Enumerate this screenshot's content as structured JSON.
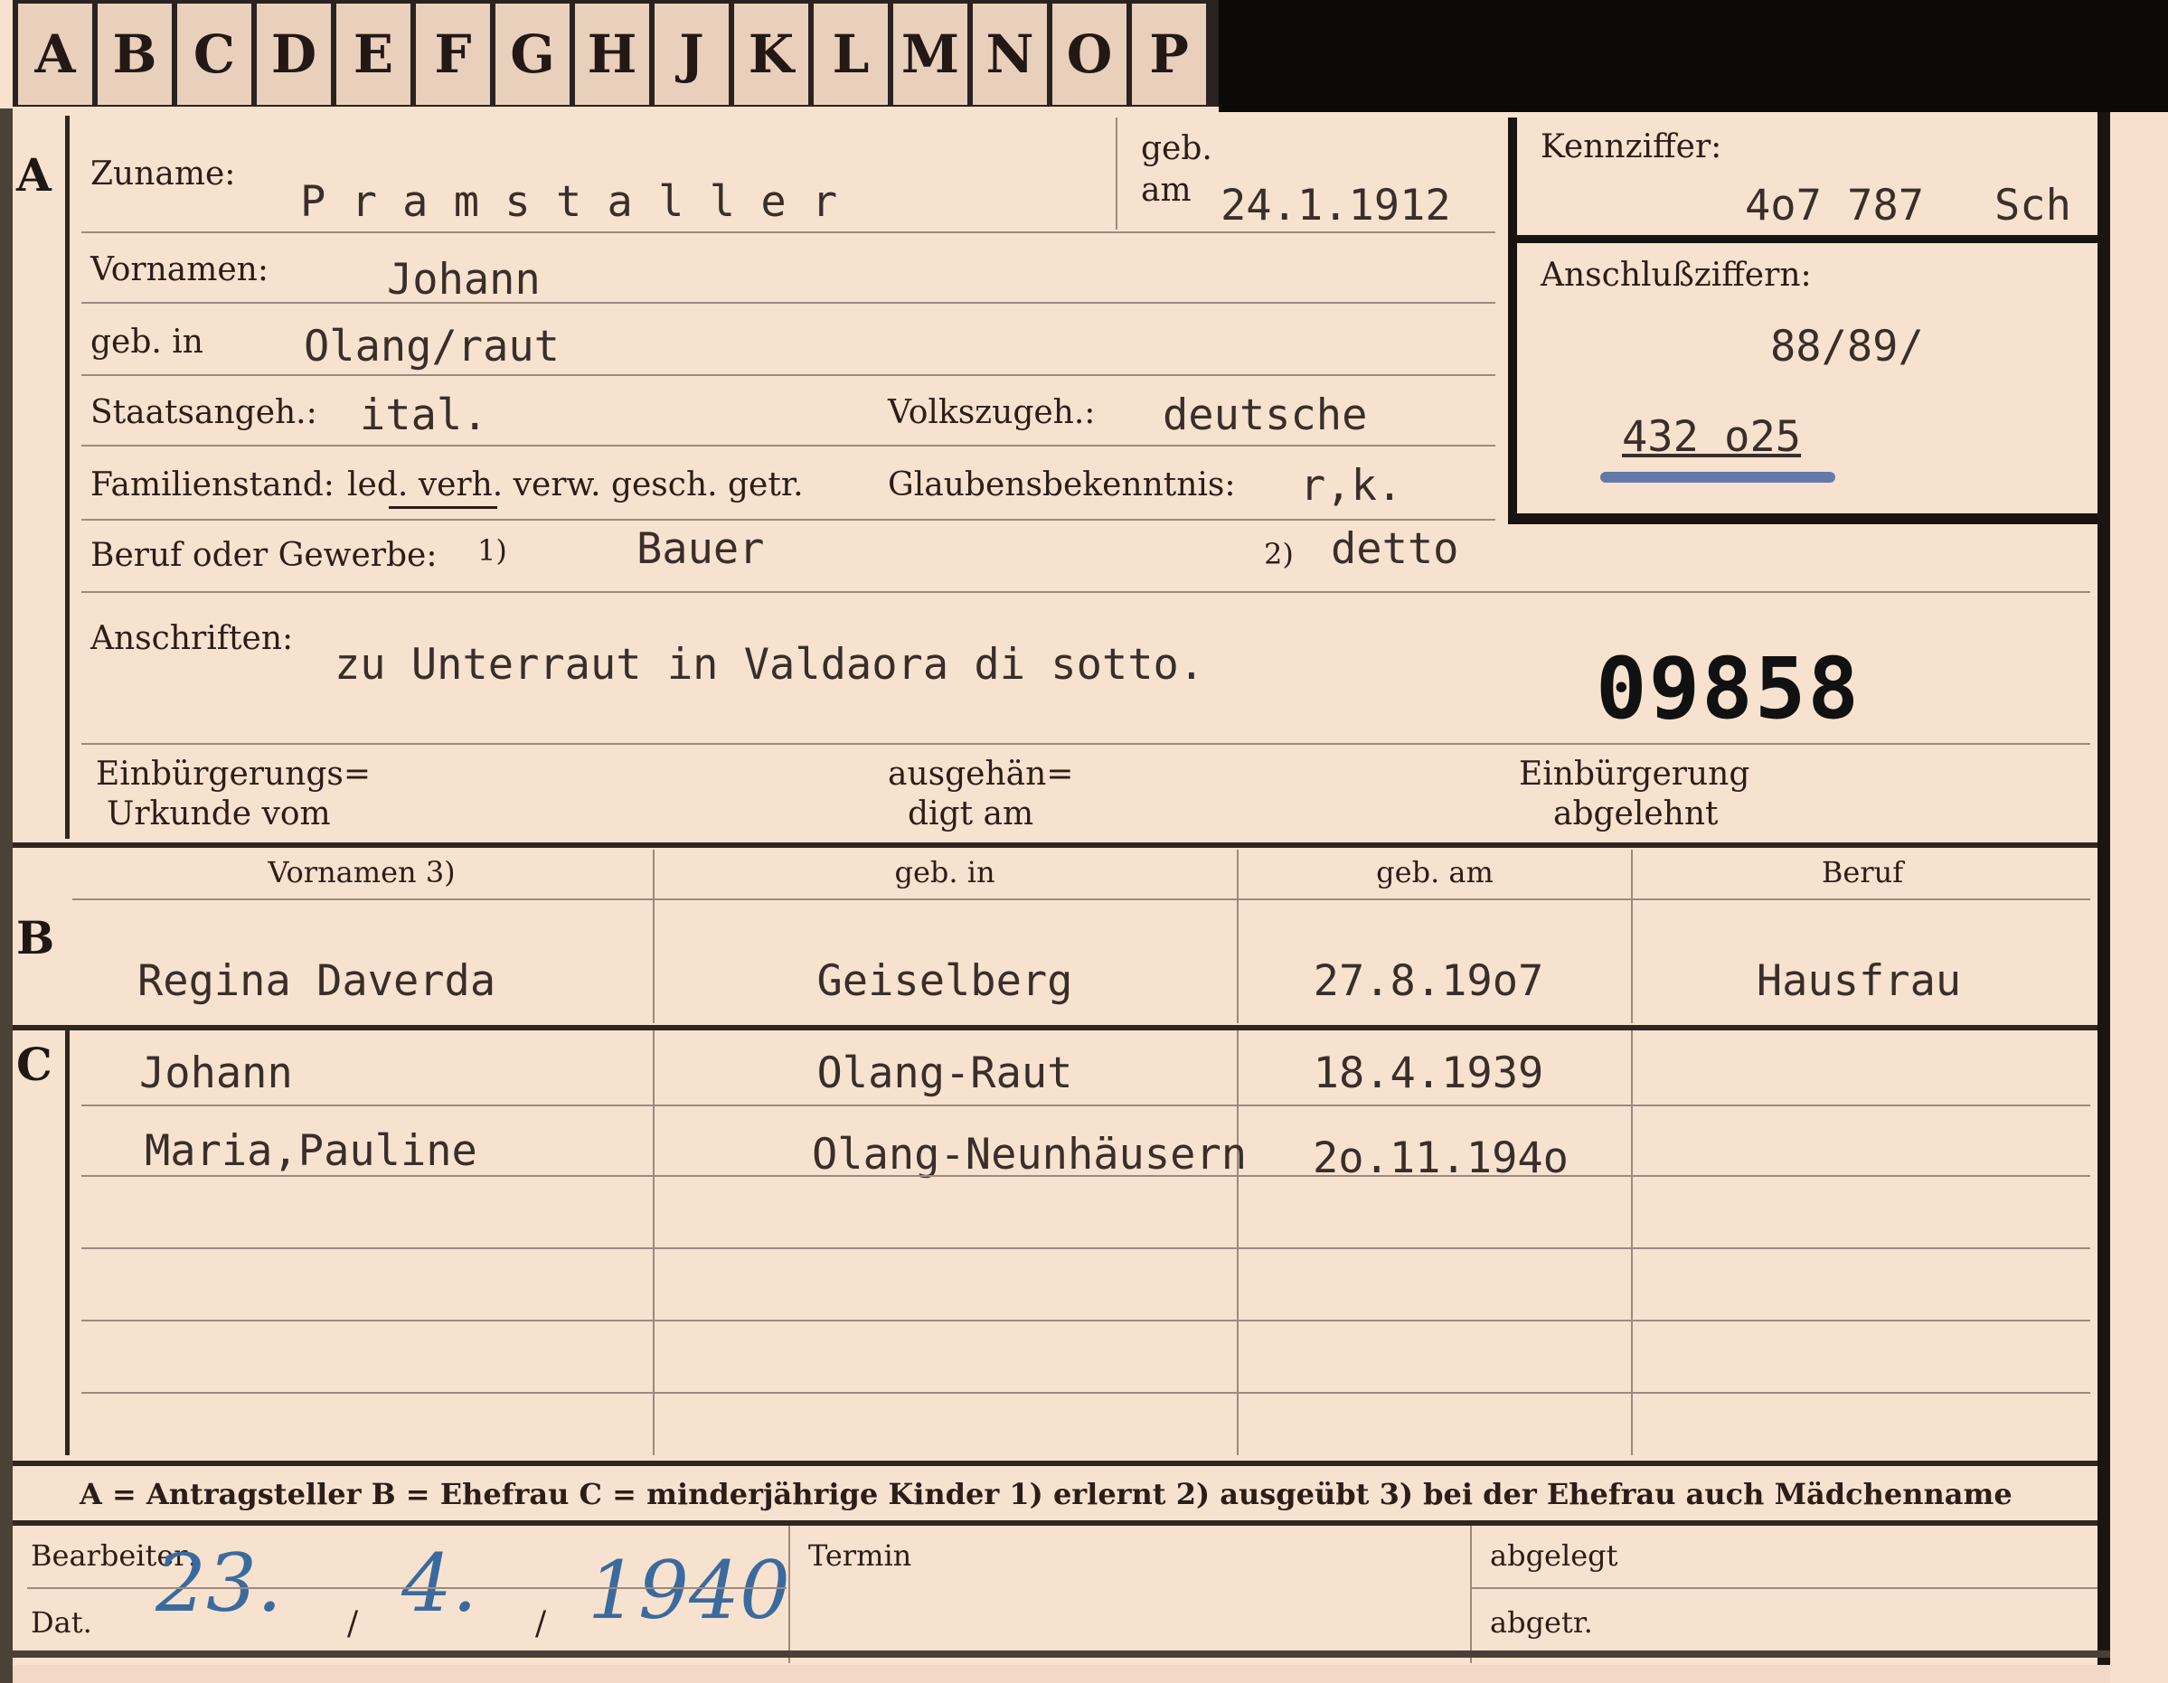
{
  "tabs": [
    "A",
    "B",
    "C",
    "D",
    "E",
    "F",
    "G",
    "H",
    "J",
    "K",
    "L",
    "M",
    "N",
    "O",
    "P"
  ],
  "section_letters": {
    "a": "A",
    "b": "B",
    "c": "C"
  },
  "section_a": {
    "surname_label": "Zuname:",
    "surname_value": "P r a m s t a l l e r",
    "born_label_line1": "geb.",
    "born_label_line2": "am",
    "born_date": "24.1.1912",
    "kennziffer_label": "Kennziffer:",
    "kennziffer_value": "4o7 787",
    "kennziffer_suffix": "Sch",
    "anschluss_label": "Anschlußziffern:",
    "anschluss_value_1": "88/89/",
    "anschluss_value_2": "432 o25",
    "firstnames_label": "Vornamen:",
    "firstnames_value": "Johann",
    "birthplace_label": "geb. in",
    "birthplace_value": "Olang/raut",
    "citizenship_label": "Staatsangeh.:",
    "citizenship_value": "ital.",
    "ethnicity_label": "Volkszugeh.:",
    "ethnicity_value": "deutsche",
    "marital_label": "Familienstand:",
    "marital_options": "led. verh. verw. gesch. getr.",
    "religion_label": "Glaubensbekenntnis:",
    "religion_value": "r,k.",
    "occupation_label": "Beruf oder Gewerbe:",
    "occupation_note1": "1)",
    "occupation_value1": "Bauer",
    "occupation_note2": "2)",
    "occupation_value2": "detto",
    "address_label": "Anschriften:",
    "address_value": "zu Unterraut in Valdaora di sotto.",
    "stamp_number": "09858",
    "naturalization_doc_line1": "Einbürgerungs=",
    "naturalization_doc_line2": "Urkunde vom",
    "handed_line1": "ausgehän=",
    "handed_line2": "digt am",
    "rejected_line1": "Einbürgerung",
    "rejected_line2": "abgelehnt"
  },
  "section_b": {
    "headers": [
      "Vornamen 3)",
      "geb. in",
      "geb. am",
      "Beruf"
    ],
    "row": [
      "Regina Daverda",
      "Geiselberg",
      "27.8.19o7",
      "Hausfrau"
    ]
  },
  "section_c": {
    "rows": [
      {
        "name": "Johann",
        "place": "Olang-Raut",
        "date": "18.4.1939"
      },
      {
        "name": "Maria,Pauline",
        "place": "Olang-Neunhäusern",
        "date": "2o.11.194o"
      }
    ]
  },
  "legend": "A = Antragsteller   B = Ehefrau   C = minderjährige Kinder   1) erlernt   2) ausgeübt   3) bei der Ehefrau auch Mädchenname",
  "footer": {
    "bearbeiter_label": "Bearbeiter:",
    "dat_label": "Dat.",
    "date_day": "23.",
    "sep1": "/",
    "date_month": "4.",
    "sep2": "/",
    "date_year": "1940",
    "termin_label": "Termin",
    "abgelegt_label": "abgelegt",
    "abgetr_label": "abgetr."
  },
  "colors": {
    "card": "#f7e2cf",
    "ink": "#2a1c16",
    "handwriting": "#3b6a9e",
    "frame": "#0c0909"
  }
}
